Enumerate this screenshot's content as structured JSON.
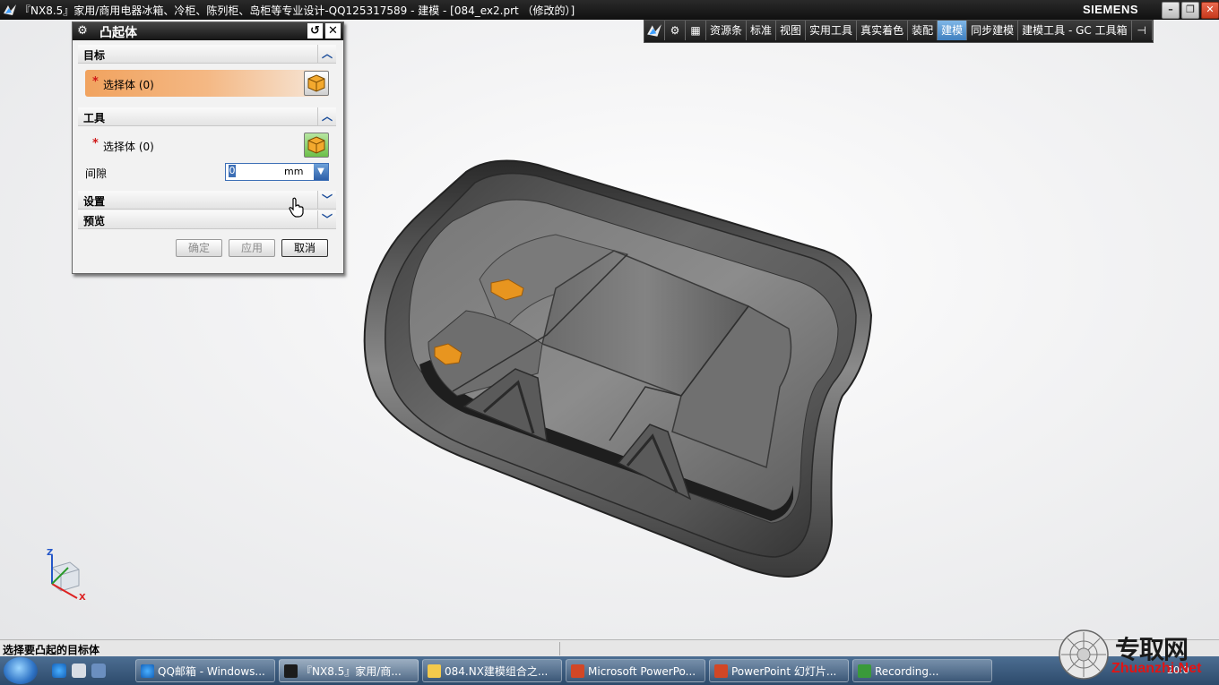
{
  "window": {
    "title": "『NX8.5』家用/商用电器冰箱、冷柜、陈列柜、岛柜等专业设计-QQ125317589 - 建模 - [084_ex2.prt （修改的）]",
    "brand": "SIEMENS"
  },
  "toolbar": {
    "items": [
      "资源条",
      "标准",
      "视图",
      "实用工具",
      "真实着色",
      "装配",
      "建模",
      "同步建模",
      "建模工具 - GC 工具箱"
    ],
    "active": "建模"
  },
  "dialog": {
    "title": "凸起体",
    "sections": {
      "target": "目标",
      "tool": "工具",
      "settings": "设置",
      "preview": "预览"
    },
    "target_select": "选择体 (0)",
    "tool_select": "选择体 (0)",
    "gap_label": "间隙",
    "gap_value": "0",
    "gap_unit": "mm",
    "buttons": {
      "ok": "确定",
      "apply": "应用",
      "cancel": "取消"
    }
  },
  "status": {
    "message": "选择要凸起的目标体"
  },
  "triad": {
    "z": "Z",
    "x": "X"
  },
  "taskbar": {
    "items": [
      "QQ邮箱 - Windows...",
      "『NX8.5』家用/商...",
      "084.NX建模组合之...",
      "Microsoft PowerPo...",
      "PowerPoint 幻灯片...",
      "Recording..."
    ],
    "clock": "20:0"
  },
  "watermark": {
    "text": "专取网",
    "url": "Zhuanzhi.Net"
  },
  "colors": {
    "selection_active": "#f1a35f",
    "titlebar": "#151515",
    "model_body": "#4a4a4a",
    "face_highlight": "#e8951f"
  }
}
